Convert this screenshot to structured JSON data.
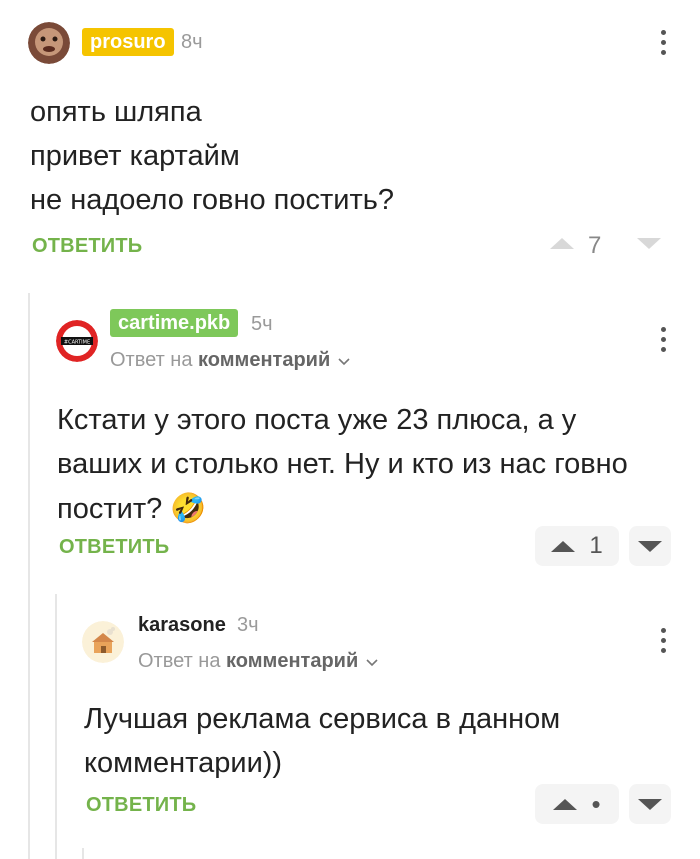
{
  "comments": [
    {
      "username": "prosuro",
      "badge_color": "#f5c400",
      "time": "8ч",
      "lines": [
        "опять шляпа",
        "привет картайм",
        "не надоело говно постить?"
      ],
      "reply_label": "ОТВЕТИТЬ",
      "score": "7"
    },
    {
      "username": "cartime.pkb",
      "badge_color": "#7ec85a",
      "time": "5ч",
      "reply_to_prefix": "Ответ на",
      "reply_to_target": "комментарий",
      "lines": [
        "Кстати у этого поста уже 23 плюса, а у",
        "ваших и столько нет. Ну и кто из нас говно",
        "постит?"
      ],
      "emoji": "🤣",
      "reply_label": "ОТВЕТИТЬ",
      "score": "1"
    },
    {
      "username": "karasone",
      "time": "3ч",
      "reply_to_prefix": "Ответ на",
      "reply_to_target": "комментарий",
      "lines": [
        "Лучшая реклама сервиса в данном",
        "комментарии))"
      ],
      "reply_label": "ОТВЕТИТЬ",
      "score": "•"
    }
  ],
  "icons": {
    "menu": "kebab-icon",
    "upvote": "arrow-up-icon",
    "downvote": "arrow-down-icon",
    "chevron": "chevron-down-icon"
  },
  "colors": {
    "reply": "#74b34b",
    "thread_line": "#e6e6e6"
  }
}
